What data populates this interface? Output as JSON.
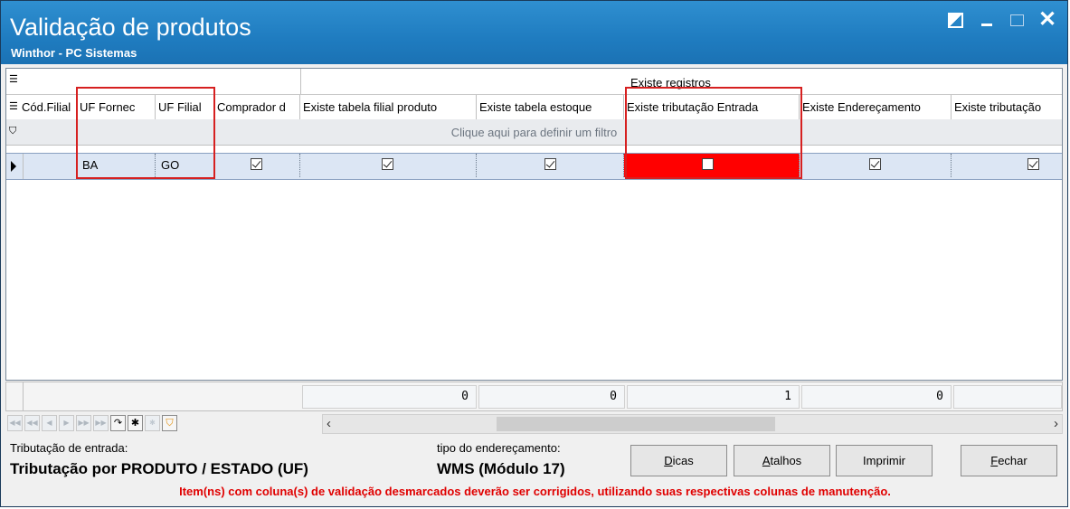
{
  "window": {
    "title": "Validação de produtos",
    "subtitle": "Winthor - PC Sistemas",
    "controls": [
      "restore-icon",
      "minimize-icon",
      "maximize-icon",
      "close-icon"
    ]
  },
  "grid": {
    "band_label": "Existe registros",
    "columns": [
      "Cód.Filial",
      "UF Fornec",
      "UF Filial",
      "Comprador d",
      "Existe tabela filial produto",
      "Existe tabela estoque",
      "Existe tributação Entrada",
      "Existe Endereçamento",
      "Existe tributação"
    ],
    "filter_text": "Clique aqui para definir um filtro",
    "row": {
      "cod_filial": "",
      "uf_fornec": "BA",
      "uf_filial": "GO",
      "comprador": true,
      "tabela_filial_produto": true,
      "tabela_estoque": true,
      "tributacao_entrada": false,
      "enderecamento": true,
      "tributacao": true
    },
    "totals": [
      "0",
      "0",
      "1",
      "0"
    ]
  },
  "colors": {
    "titlebar": "#1f7cc0",
    "invalid_cell": "#ff0000",
    "highlight": "#d62020",
    "warning_text": "#e00000"
  },
  "info": {
    "trib_label": "Tributação de entrada:",
    "trib_value": "Tributação por PRODUTO / ESTADO (UF)",
    "ender_label": "tipo do endereçamento:",
    "ender_value": "WMS (Módulo 17)"
  },
  "buttons": {
    "dicas_first": "D",
    "dicas_rest": "icas",
    "atalhos_first": "A",
    "atalhos_rest": "talhos",
    "imprimir": "Imprimir",
    "fechar_first": "F",
    "fechar_rest": "echar"
  },
  "warning": "Item(ns) com coluna(s) de validação desmarcados deverão ser corrigidos, utilizando suas respectivas colunas de manutenção."
}
